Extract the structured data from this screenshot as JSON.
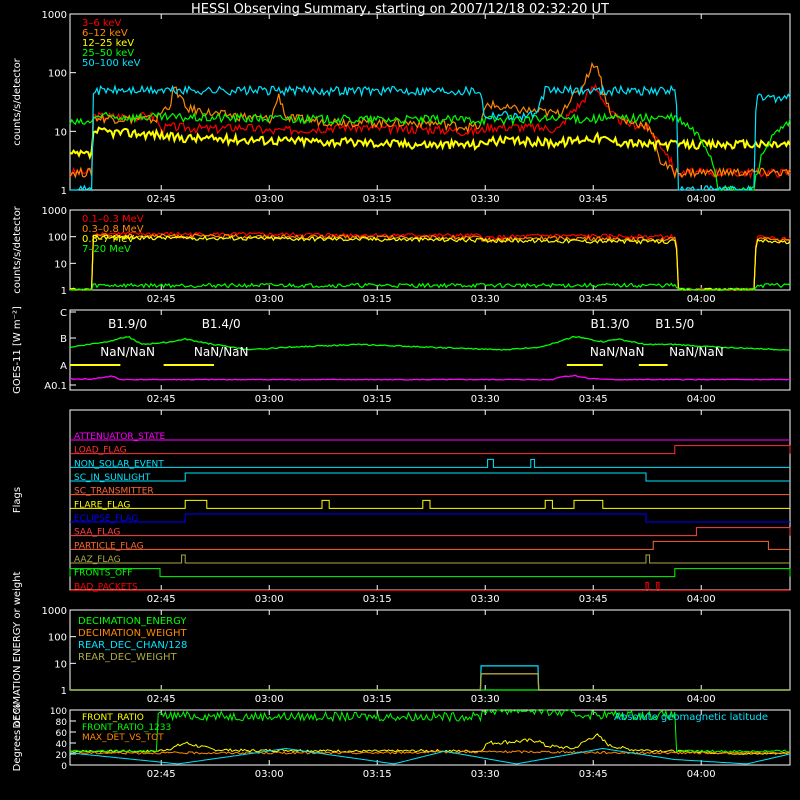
{
  "title": "HESSI Observing Summary, starting on 2007/12/18 02:32:20 UT",
  "time_ticks": [
    "02:45",
    "03:00",
    "03:15",
    "03:30",
    "03:45",
    "04:00"
  ],
  "time_tick_minutes": [
    12.67,
    27.67,
    42.67,
    57.67,
    72.67,
    87.67
  ],
  "time_span_minutes": [
    0,
    100
  ],
  "colors": {
    "background": "#000000",
    "axes": "#ffffff",
    "red": "#ff0000",
    "orange": "#ff8800",
    "yellow": "#ffff00",
    "green": "#00ff00",
    "cyan": "#00e5ff",
    "magenta": "#ff00ff",
    "blue": "#0000ff",
    "olive": "#aaaa44",
    "salmon": "#ff6655"
  },
  "chart_data": [
    {
      "type": "line",
      "panel": "count rates low energy",
      "ylabel": "counts/s/detector",
      "yscale": "log",
      "ylim": [
        1,
        1000
      ],
      "yticks": [
        "1",
        "10",
        "100",
        "1000"
      ],
      "legend_position": "top-left",
      "series": [
        {
          "name": "3–6 keV",
          "color": "#ff0000",
          "x": [
            0,
            3,
            3.1,
            12,
            12.5,
            14,
            20,
            24,
            28,
            33,
            38,
            44,
            50,
            55,
            57,
            58,
            62,
            68,
            71,
            73,
            74,
            75,
            77,
            80,
            82,
            84
          ],
          "y": [
            2,
            2,
            18,
            18,
            11,
            12,
            11,
            12,
            10,
            11,
            12,
            11,
            11,
            10,
            10,
            12,
            12,
            11,
            30,
            60,
            35,
            20,
            14,
            12,
            6,
            2
          ]
        },
        {
          "name": "6–12 keV",
          "color": "#ff8800",
          "x": [
            0,
            3,
            3.1,
            12,
            14,
            14.5,
            16,
            20,
            24,
            28,
            29,
            30,
            35,
            44,
            50,
            55,
            57,
            58,
            60,
            68,
            71,
            73,
            74,
            75,
            77,
            80,
            82,
            84
          ],
          "y": [
            2,
            2,
            17,
            16,
            30,
            55,
            25,
            20,
            18,
            16,
            40,
            17,
            15,
            14,
            14,
            12,
            12,
            30,
            25,
            20,
            50,
            150,
            50,
            20,
            15,
            13,
            3,
            2
          ]
        },
        {
          "name": "12–25 keV",
          "color": "#ffff00",
          "x": [
            0,
            3,
            3.1,
            12,
            14,
            20,
            30,
            40,
            50,
            57,
            58,
            68,
            73,
            75,
            80,
            84
          ],
          "y": [
            4,
            4,
            10,
            9,
            8,
            7.5,
            7,
            6.5,
            6,
            6,
            7,
            6.5,
            8,
            7,
            6,
            6
          ]
        },
        {
          "name": "25–50 keV",
          "color": "#00ff00",
          "x": [
            0,
            3,
            3.1,
            20,
            40,
            57,
            60,
            80,
            84,
            90,
            95,
            100
          ],
          "y": [
            14,
            14,
            18,
            17,
            16,
            16,
            16,
            17,
            17,
            1,
            1,
            14
          ]
        },
        {
          "name": "50–100 keV",
          "color": "#00e5ff",
          "x": [
            0,
            3,
            3.1,
            57,
            57.5,
            60,
            62,
            65,
            66,
            84,
            84.5,
            95,
            95.5,
            100
          ],
          "y": [
            1,
            1,
            50,
            50,
            18,
            20,
            18,
            20,
            50,
            50,
            1,
            1,
            38,
            38
          ]
        }
      ]
    },
    {
      "type": "line",
      "panel": "count rates high energy",
      "ylabel": "counts/s/detector",
      "yscale": "log",
      "ylim": [
        1,
        1000
      ],
      "yticks": [
        "1",
        "10",
        "100",
        "1000"
      ],
      "legend_position": "top-left",
      "series": [
        {
          "name": "0.1–0.3 MeV",
          "color": "#ff0000",
          "x": [
            0,
            3,
            3.1,
            30,
            57,
            57.5,
            66,
            84,
            84.5,
            95,
            95.5,
            100
          ],
          "y": [
            1,
            1,
            130,
            120,
            110,
            90,
            110,
            100,
            1,
            1,
            100,
            80
          ]
        },
        {
          "name": "0.3–0.8 MeV",
          "color": "#ff8800",
          "x": [
            0,
            3,
            3.1,
            30,
            57,
            57.5,
            66,
            84,
            84.5,
            95,
            95.5,
            100
          ],
          "y": [
            1,
            1,
            110,
            100,
            90,
            75,
            90,
            80,
            1,
            1,
            85,
            70
          ]
        },
        {
          "name": "0.8–7 MeV",
          "color": "#ffff00",
          "x": [
            0,
            3,
            3.1,
            30,
            57,
            66,
            84,
            84.5,
            95,
            95.5,
            100
          ],
          "y": [
            1,
            1,
            95,
            85,
            75,
            70,
            65,
            1,
            1,
            70,
            60
          ]
        },
        {
          "name": "7–20 MeV",
          "color": "#00ff00",
          "x": [
            0,
            3,
            3.1,
            84,
            84.5,
            95,
            95.5,
            100
          ],
          "y": [
            1,
            1,
            1.5,
            1.5,
            1,
            1,
            1.5,
            1.5
          ]
        }
      ]
    },
    {
      "type": "line",
      "panel": "GOES",
      "ylabel": "GOES-11 [W m⁻²]",
      "ytick_labels": [
        "A0.1",
        "A",
        "B",
        "C"
      ],
      "annotations": [
        "B1.9/0",
        "B1.4/0",
        "B1.3/0",
        "B1.5/0",
        "NaN/NaN",
        "NaN/NaN",
        "NaN/NaN",
        "NaN/NaN"
      ],
      "series": [
        {
          "name": "goes_long",
          "color": "#00ff00",
          "x": [
            0,
            5,
            8,
            10,
            14,
            16,
            20,
            25,
            30,
            40,
            50,
            60,
            65,
            68,
            70,
            74,
            76,
            80,
            84,
            90,
            100
          ],
          "y": [
            1.4,
            1.6,
            1.8,
            1.5,
            1.6,
            1.7,
            1.5,
            1.3,
            1.4,
            1.5,
            1.4,
            1.3,
            1.4,
            1.6,
            1.8,
            1.6,
            1.7,
            1.5,
            1.5,
            1.4,
            1.3
          ]
        },
        {
          "name": "goes_short",
          "color": "#ff00ff",
          "x": [
            0,
            3,
            5,
            6,
            7,
            10,
            20,
            30,
            40,
            50,
            60,
            67,
            68,
            70,
            72,
            75,
            80,
            90,
            100
          ],
          "y": [
            0.22,
            0.22,
            0.3,
            0.32,
            0.2,
            0.2,
            0.2,
            0.2,
            0.2,
            0.2,
            0.2,
            0.2,
            0.3,
            0.35,
            0.25,
            0.2,
            0.2,
            0.2,
            0.2
          ]
        }
      ]
    },
    {
      "type": "line",
      "panel": "Flags",
      "ylabel": "Flags",
      "flags": [
        {
          "name": "ATTENUATOR_STATE",
          "color": "#ff00ff",
          "steps": []
        },
        {
          "name": "LOAD_FLAG",
          "color": "#ff3333",
          "steps": [
            [
              84,
              100
            ]
          ]
        },
        {
          "name": "NON_SOLAR_EVENT",
          "color": "#00e5ff",
          "steps": [
            [
              58,
              58.8
            ],
            [
              64,
              64.5
            ]
          ]
        },
        {
          "name": "SC_IN_SUNLIGHT",
          "color": "#00e5ff",
          "steps": [
            [
              16,
              80
            ]
          ]
        },
        {
          "name": "SC_TRANSMITTER",
          "color": "#ff6633",
          "steps": []
        },
        {
          "name": "FLARE_FLAG",
          "color": "#ffff00",
          "steps": [
            [
              16,
              19
            ],
            [
              35,
              36
            ],
            [
              49,
              50
            ],
            [
              66,
              67
            ],
            [
              70,
              74
            ]
          ]
        },
        {
          "name": "ECLIPSE_FLAG",
          "color": "#0000ff",
          "steps": [
            [
              16,
              80
            ]
          ]
        },
        {
          "name": "SAA_FLAG",
          "color": "#ff4444",
          "steps": [
            [
              87,
              100
            ]
          ]
        },
        {
          "name": "PARTICLE_FLAG",
          "color": "#ff6633",
          "steps": [
            [
              81,
              97
            ]
          ]
        },
        {
          "name": "AAZ_FLAG",
          "color": "#aaaa44",
          "steps": [
            [
              15.5,
              16
            ],
            [
              80,
              80.5
            ]
          ]
        },
        {
          "name": "FRONTS_OFF",
          "color": "#00ff00",
          "steps": [
            [
              0,
              12.5
            ],
            [
              84,
              100
            ]
          ]
        },
        {
          "name": "BAD_PACKETS",
          "color": "#ff0000",
          "steps": [
            [
              80,
              80.3
            ],
            [
              81.5,
              81.8
            ]
          ]
        }
      ]
    },
    {
      "type": "line",
      "panel": "Decimation",
      "ylabel": "DECIMATION ENERGY or weight",
      "yscale": "log",
      "ylim": [
        1,
        1000
      ],
      "yticks": [
        "1",
        "10",
        "100",
        "1000"
      ],
      "series": [
        {
          "name": "DECIMATION_ENERGY",
          "color": "#00ff00",
          "x": [
            0,
            100
          ],
          "y": [
            1,
            1
          ]
        },
        {
          "name": "DECIMATION_WEIGHT",
          "color": "#ff8800",
          "x": [
            0,
            57,
            57.1,
            65,
            65.1,
            100
          ],
          "y": [
            1,
            1,
            4,
            4,
            1,
            1
          ]
        },
        {
          "name": "REAR_DEC_CHAN/128",
          "color": "#00e5ff",
          "x": [
            0,
            57,
            57.1,
            65,
            65.1,
            100
          ],
          "y": [
            1,
            1,
            8,
            8,
            1,
            1
          ]
        },
        {
          "name": "REAR_DEC_WEIGHT",
          "color": "#aaaa44",
          "x": [
            0,
            57,
            57.1,
            65,
            65.1,
            100
          ],
          "y": [
            1,
            1,
            4,
            4,
            1,
            1
          ]
        }
      ]
    },
    {
      "type": "line",
      "panel": "Ratios",
      "ylabel": "Degrees or %",
      "ylim": [
        0,
        100
      ],
      "yticks": [
        "0",
        "20",
        "40",
        "60",
        "80",
        "100"
      ],
      "annotation": "Absolute geomagnetic latitude",
      "series": [
        {
          "name": "FRONT_RATIO",
          "color": "#ffff00",
          "x": [
            0,
            12,
            14,
            16,
            20,
            25,
            30,
            40,
            50,
            57,
            58,
            65,
            66,
            70,
            73,
            75,
            78,
            84,
            95,
            100
          ],
          "y": [
            25,
            25,
            30,
            40,
            28,
            26,
            27,
            25,
            26,
            25,
            40,
            45,
            35,
            30,
            55,
            35,
            28,
            25,
            20,
            22
          ]
        },
        {
          "name": "FRONT_RATIO_1233",
          "color": "#00ff00",
          "x": [
            0,
            12,
            12.1,
            30,
            57,
            57.5,
            65,
            70,
            84,
            84.1,
            95,
            100
          ],
          "y": [
            25,
            25,
            90,
            88,
            88,
            100,
            100,
            92,
            90,
            25,
            25,
            25
          ]
        },
        {
          "name": "MAX_DET_VS_TOT",
          "color": "#ff8800",
          "x": [
            0,
            20,
            40,
            57,
            65,
            80,
            84,
            100
          ],
          "y": [
            22,
            22,
            22,
            24,
            24,
            22,
            22,
            22
          ]
        },
        {
          "name": "Absolute geomagnetic latitude",
          "color": "#00e5ff",
          "x": [
            0,
            15,
            30,
            45,
            52,
            62,
            74,
            84,
            94,
            100
          ],
          "y": [
            22,
            2,
            30,
            2,
            25,
            2,
            30,
            10,
            2,
            20
          ]
        }
      ]
    }
  ]
}
